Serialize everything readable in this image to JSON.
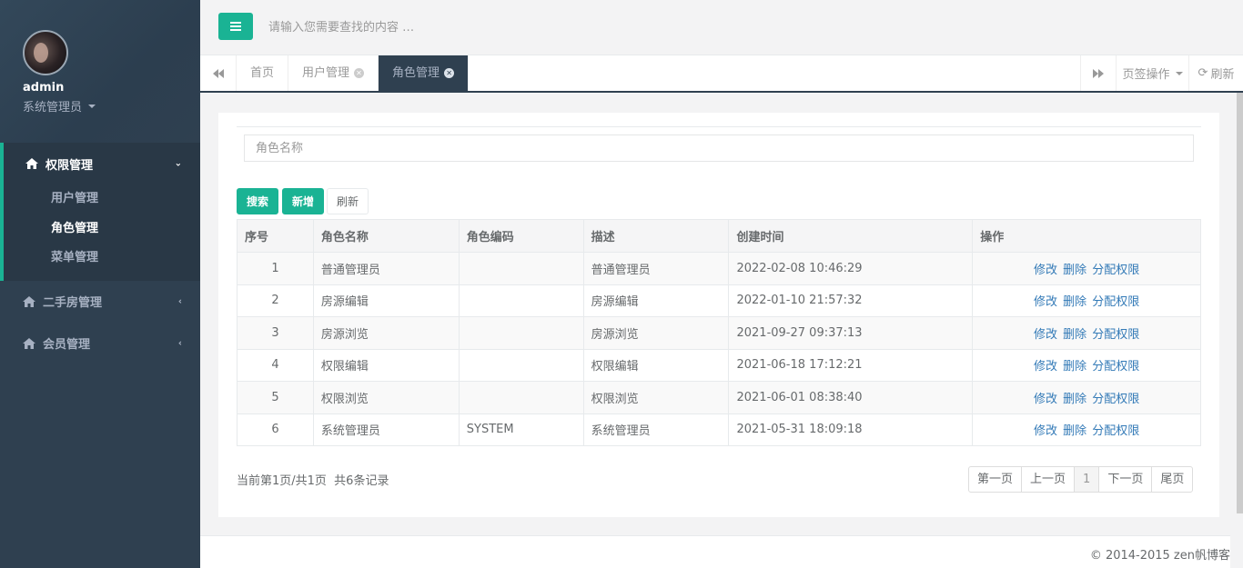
{
  "sidebar": {
    "user_name": "admin",
    "user_role": "系统管理员",
    "groups": [
      {
        "label": "权限管理",
        "arrow": "⌄",
        "items": [
          {
            "label": "用户管理"
          },
          {
            "label": "角色管理"
          },
          {
            "label": "菜单管理"
          }
        ]
      },
      {
        "label": "二手房管理",
        "arrow": "‹"
      },
      {
        "label": "会员管理",
        "arrow": "‹"
      }
    ]
  },
  "topbar": {
    "search_placeholder": "请输入您需要查找的内容 …"
  },
  "tabs": {
    "items": [
      {
        "label": "首页"
      },
      {
        "label": "用户管理"
      },
      {
        "label": "角色管理"
      }
    ],
    "ops_label": "页签操作",
    "refresh_label": "刷新"
  },
  "panel": {
    "role_placeholder": "角色名称",
    "search_btn": "搜索",
    "add_btn": "新增",
    "refresh_btn": "刷新",
    "columns": [
      "序号",
      "角色名称",
      "角色编码",
      "描述",
      "创建时间",
      "操作"
    ],
    "rows": [
      {
        "no": "1",
        "name": "普通管理员",
        "code": "",
        "desc": "普通管理员",
        "created": "2022-02-08 10:46:29"
      },
      {
        "no": "2",
        "name": "房源编辑",
        "code": "",
        "desc": "房源编辑",
        "created": "2022-01-10 21:57:32"
      },
      {
        "no": "3",
        "name": "房源浏览",
        "code": "",
        "desc": "房源浏览",
        "created": "2021-09-27 09:37:13"
      },
      {
        "no": "4",
        "name": "权限编辑",
        "code": "",
        "desc": "权限编辑",
        "created": "2021-06-18 17:12:21"
      },
      {
        "no": "5",
        "name": "权限浏览",
        "code": "",
        "desc": "权限浏览",
        "created": "2021-06-01 08:38:40"
      },
      {
        "no": "6",
        "name": "系统管理员",
        "code": "SYSTEM",
        "desc": "系统管理员",
        "created": "2021-05-31 18:09:18"
      }
    ],
    "op_edit": "修改",
    "op_delete": "删除",
    "op_assign": "分配权限",
    "pager_info": "当前第1页/共1页  共6条记录",
    "pager": {
      "first": "第一页",
      "prev": "上一页",
      "current": "1",
      "next": "下一页",
      "last": "尾页"
    }
  },
  "footer": {
    "text": "© 2014-2015 zen帆博客"
  },
  "colors": {
    "accent": "#1ab394",
    "sidebar_bg": "#2f4050",
    "link": "#337ab7"
  }
}
